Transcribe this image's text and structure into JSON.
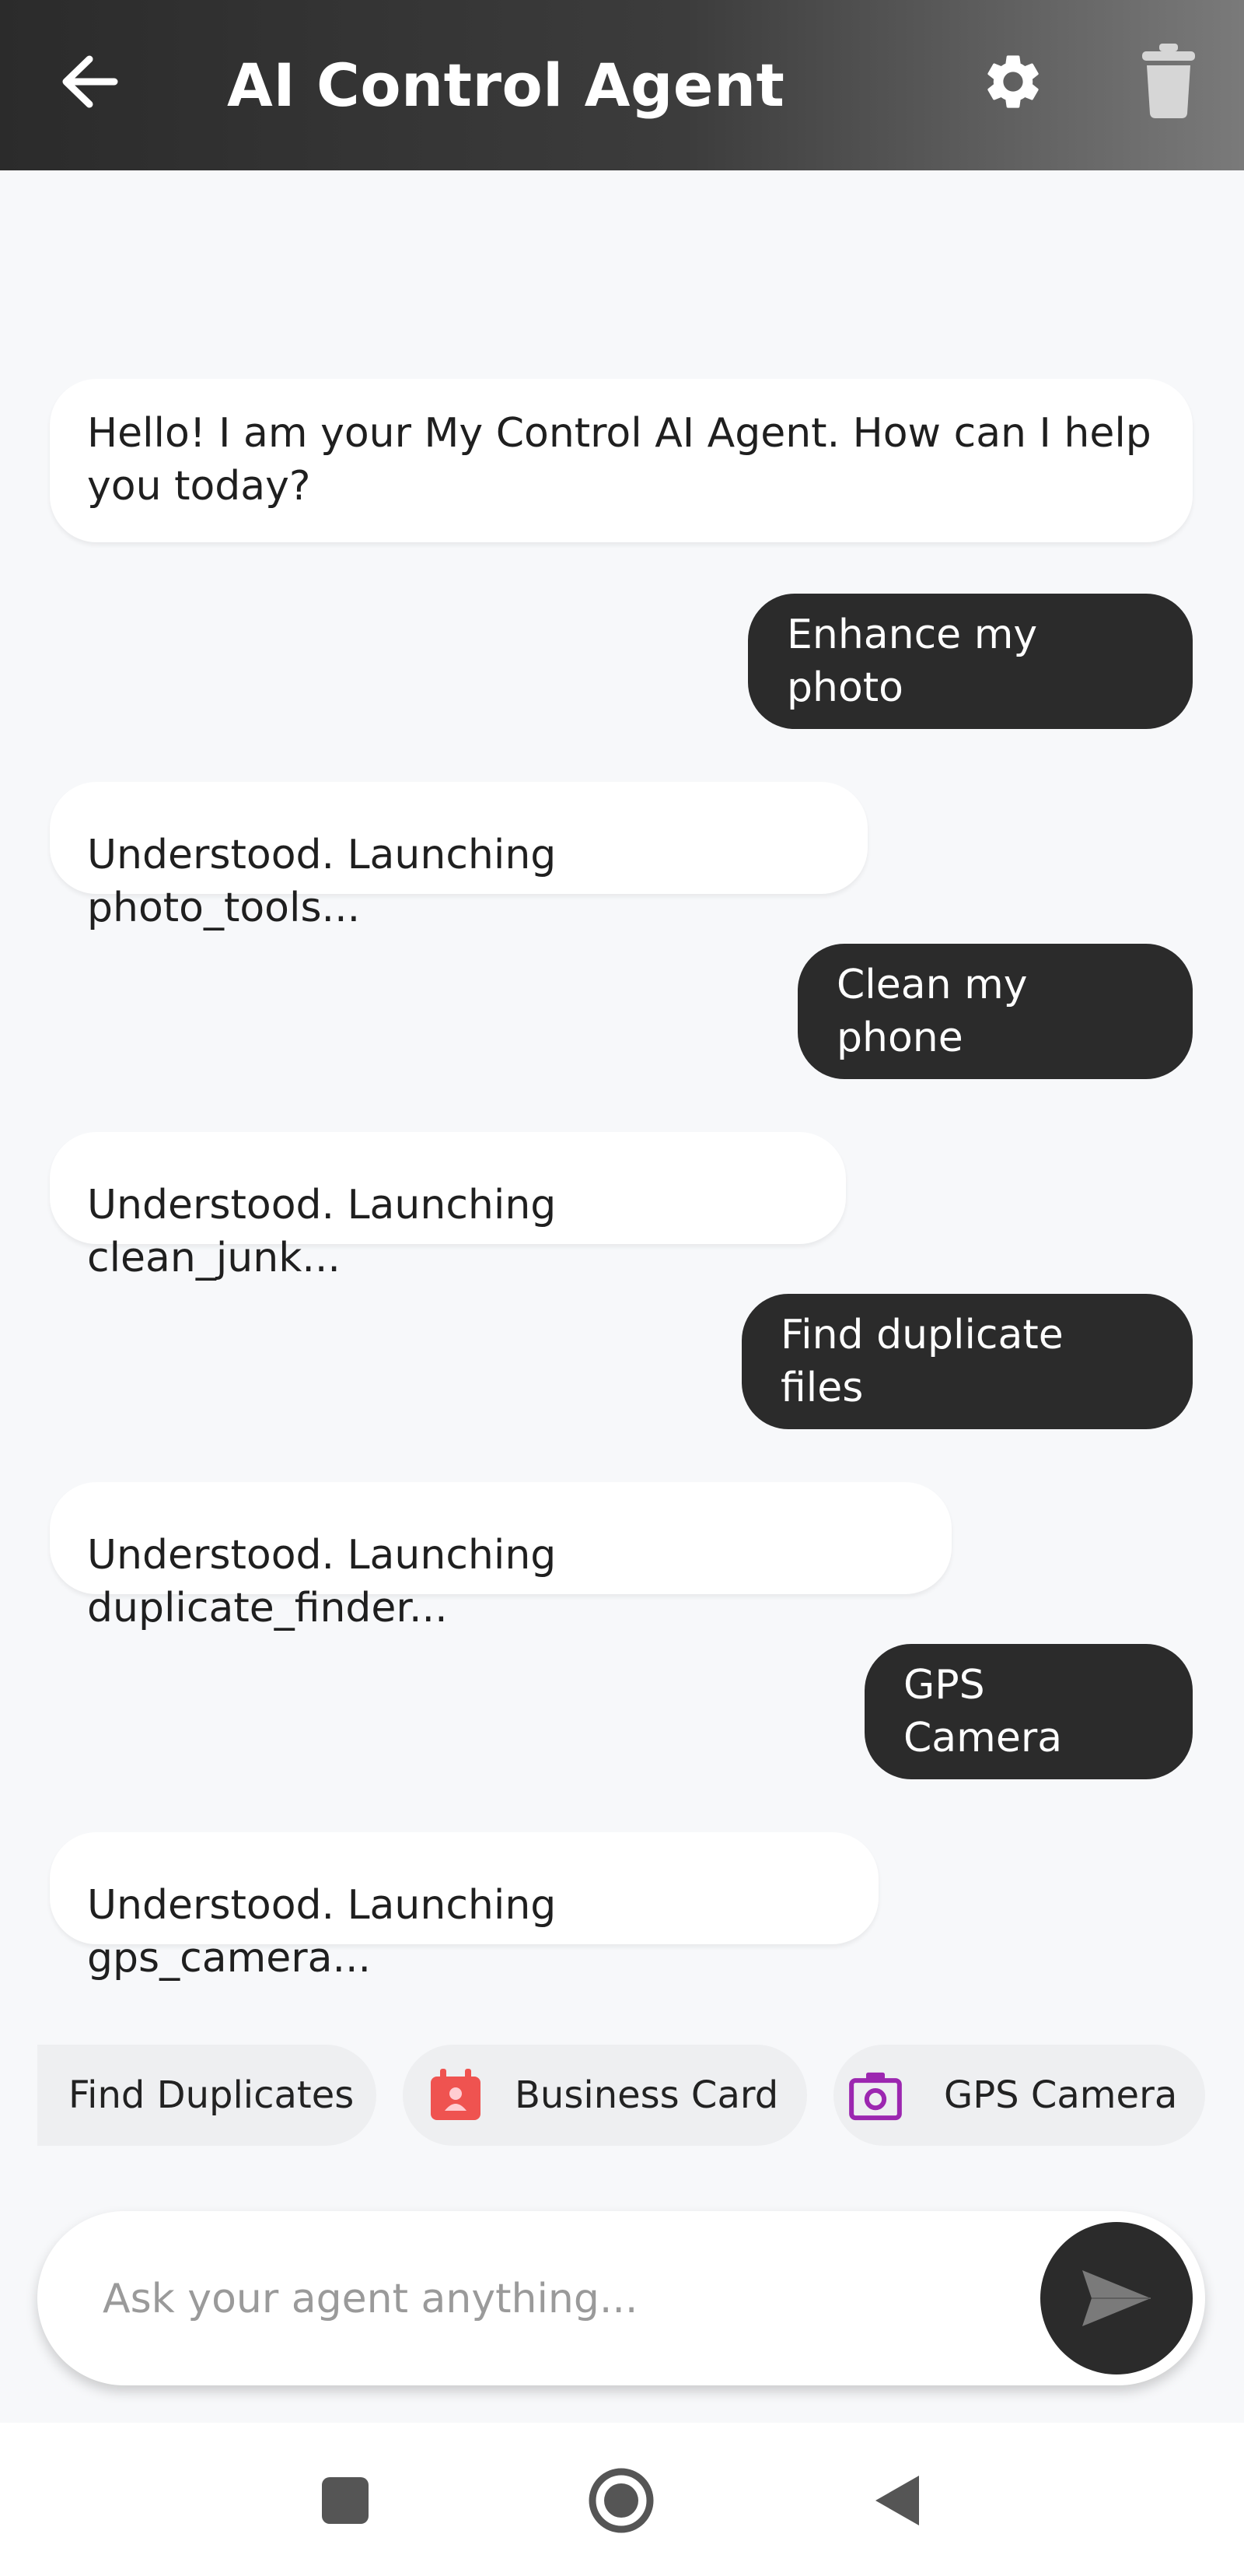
{
  "header": {
    "title": "AI Control Agent",
    "back_icon": "arrow-left-icon",
    "settings_icon": "gear-icon",
    "trash_icon": "trash-icon"
  },
  "conversation": [
    {
      "role": "agent",
      "text": "Hello! I am your My Control AI Agent. How can I help you today?"
    },
    {
      "role": "user",
      "text": "Enhance my photo"
    },
    {
      "role": "agent",
      "text": "Understood. Launching photo_tools..."
    },
    {
      "role": "user",
      "text": "Clean my phone"
    },
    {
      "role": "agent",
      "text": "Understood. Launching clean_junk..."
    },
    {
      "role": "user",
      "text": "Find duplicate files"
    },
    {
      "role": "agent",
      "text": "Understood. Launching duplicate_finder..."
    },
    {
      "role": "user",
      "text": "GPS Camera"
    },
    {
      "role": "agent",
      "text": "Understood. Launching gps_camera..."
    }
  ],
  "quick_actions": [
    {
      "label": "Find Duplicates",
      "icon": ""
    },
    {
      "label": "Business Card",
      "icon": "business-card-icon",
      "color": "#ef5350"
    },
    {
      "label": "GPS Camera",
      "icon": "camera-icon",
      "color": "#9c27b0"
    }
  ],
  "input": {
    "placeholder": "Ask your agent anything...",
    "value": "",
    "send_icon": "send-icon"
  },
  "system_nav": {
    "recents_icon": "square-icon",
    "home_icon": "circle-icon",
    "back_icon": "triangle-back-icon"
  },
  "colors": {
    "user_bubble": "#2b2b2b",
    "agent_bubble": "#ffffff",
    "background": "#f7f8fa"
  }
}
